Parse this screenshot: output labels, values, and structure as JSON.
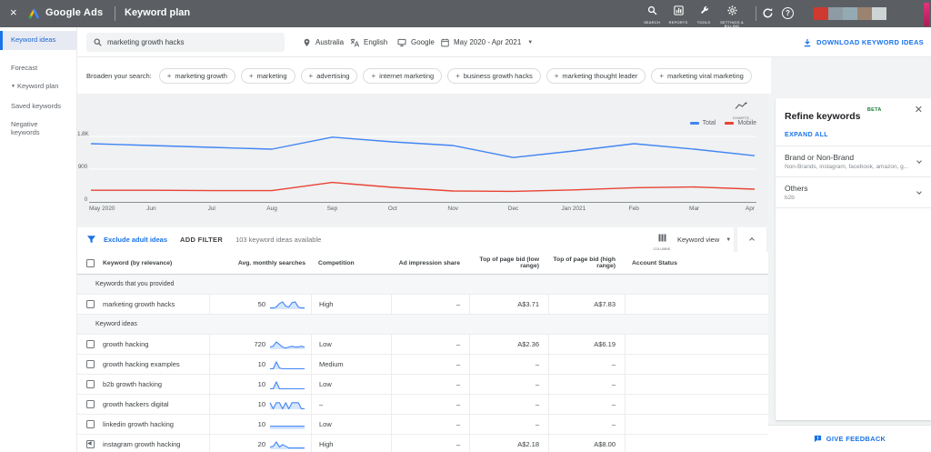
{
  "topbar": {
    "brand": "Google Ads",
    "page_title": "Keyword plan",
    "nav": [
      {
        "label": "SEARCH"
      },
      {
        "label": "REPORTS"
      },
      {
        "label": "TOOLS"
      },
      {
        "label": "SETTINGS & BILLING"
      }
    ],
    "avatar_colors": [
      "#cf3a30",
      "#8d9ba4",
      "#94aab3",
      "#9b8370",
      "#ccd5d4"
    ]
  },
  "sidebar": {
    "items": [
      {
        "label": "Keyword ideas"
      },
      {
        "label": "Forecast"
      },
      {
        "label": "Keyword plan"
      },
      {
        "label": "Saved keywords"
      },
      {
        "label": "Negative keywords"
      }
    ]
  },
  "toolbar": {
    "query": "marketing growth hacks",
    "location": "Australia",
    "language": "English",
    "network": "Google",
    "date_range": "May 2020 - Apr 2021",
    "download_label": "DOWNLOAD KEYWORD IDEAS"
  },
  "broaden": {
    "label": "Broaden your search:",
    "chips": [
      "marketing growth",
      "marketing",
      "advertising",
      "internet marketing",
      "business growth hacks",
      "marketing thought leader",
      "marketing viral marketing"
    ]
  },
  "chart_data": {
    "type": "line",
    "title": "",
    "x": [
      "May 2020",
      "Jun",
      "Jul",
      "Aug",
      "Sep",
      "Oct",
      "Nov",
      "Dec",
      "Jan 2021",
      "Feb",
      "Mar",
      "Apr"
    ],
    "series": [
      {
        "name": "Total",
        "color": "#4285f4",
        "values": [
          1600,
          1550,
          1500,
          1450,
          1780,
          1650,
          1550,
          1220,
          1400,
          1600,
          1450,
          1270
        ]
      },
      {
        "name": "Mobile",
        "color": "#ea4335",
        "values": [
          320,
          320,
          310,
          310,
          535,
          400,
          300,
          290,
          330,
          390,
          410,
          350
        ]
      }
    ],
    "yticks": [
      "1.8K",
      "900",
      "0"
    ],
    "ylim": [
      0,
      1800
    ],
    "grid": true,
    "legend_position": "top-right",
    "charts_label": "CHARTS"
  },
  "filter_bar": {
    "exclude_link": "Exclude adult ideas",
    "add_filter": "ADD FILTER",
    "count_text": "103 keyword ideas available",
    "columns_label": "COLUMNS",
    "view_selector": "Keyword view"
  },
  "table": {
    "headers": [
      "Keyword (by relevance)",
      "Avg. monthly searches",
      "Competition",
      "Ad impression share",
      "Top of page bid (low range)",
      "Top of page bid (high range)",
      "Account Status"
    ],
    "sections": [
      {
        "label": "Keywords that you provided",
        "rows": [
          {
            "keyword": "marketing growth hacks",
            "searches": "50",
            "trend": [
              1,
              1,
              2,
              6,
              8,
              3,
              2,
              7,
              8,
              2,
              1,
              1
            ],
            "competition": "High",
            "ad_share": "–",
            "bid_low": "A$3.71",
            "bid_high": "A$7.83",
            "account_status": ""
          }
        ]
      },
      {
        "label": "Keyword ideas",
        "rows": [
          {
            "keyword": "growth hacking",
            "searches": "720",
            "trend": [
              2,
              3,
              8,
              5,
              2,
              1,
              2,
              3,
              2,
              2,
              3,
              2
            ],
            "competition": "Low",
            "ad_share": "–",
            "bid_low": "A$2.36",
            "bid_high": "A$6.19",
            "account_status": ""
          },
          {
            "keyword": "growth hacking examples",
            "searches": "10",
            "trend": [
              0,
              0,
              8,
              1,
              0,
              0,
              0,
              0,
              0,
              0,
              0,
              0
            ],
            "competition": "Medium",
            "ad_share": "–",
            "bid_low": "–",
            "bid_high": "–",
            "account_status": ""
          },
          {
            "keyword": "b2b growth hacking",
            "searches": "10",
            "trend": [
              0,
              0,
              8,
              0,
              0,
              0,
              0,
              0,
              0,
              0,
              0,
              0
            ],
            "competition": "Low",
            "ad_share": "–",
            "bid_low": "–",
            "bid_high": "–",
            "account_status": ""
          },
          {
            "keyword": "growth hackers digital",
            "searches": "10",
            "trend": [
              7,
              0,
              7,
              7,
              0,
              7,
              0,
              7,
              7,
              7,
              0,
              0
            ],
            "competition": "–",
            "ad_share": "–",
            "bid_low": "–",
            "bid_high": "–",
            "account_status": ""
          },
          {
            "keyword": "linkedin growth hacking",
            "searches": "10",
            "trend": [
              3,
              3,
              3,
              3,
              3,
              3,
              3,
              3,
              3,
              3,
              3,
              3
            ],
            "competition": "Low",
            "ad_share": "–",
            "bid_low": "–",
            "bid_high": "–",
            "account_status": ""
          },
          {
            "keyword": "instagram growth hacking",
            "searches": "20",
            "trend": [
              2,
              3,
              8,
              2,
              5,
              3,
              1,
              1,
              1,
              1,
              1,
              1
            ],
            "competition": "High",
            "ad_share": "–",
            "bid_low": "A$2.18",
            "bid_high": "A$8.00",
            "account_status": ""
          }
        ]
      }
    ]
  },
  "refine_panel": {
    "title": "Refine keywords",
    "beta_badge": "BETA",
    "expand_all": "EXPAND ALL",
    "groups": [
      {
        "title": "Brand or Non-Brand",
        "subtitle": "Non-Brands, instagram, facebook, amazon, g..."
      },
      {
        "title": "Others",
        "subtitle": "b2b"
      }
    ],
    "feedback_label": "GIVE FEEDBACK"
  },
  "colors": {
    "accent": "#1a73e8",
    "line_total": "#4285f4",
    "line_mobile": "#ea4335",
    "beta_green": "#188038"
  }
}
